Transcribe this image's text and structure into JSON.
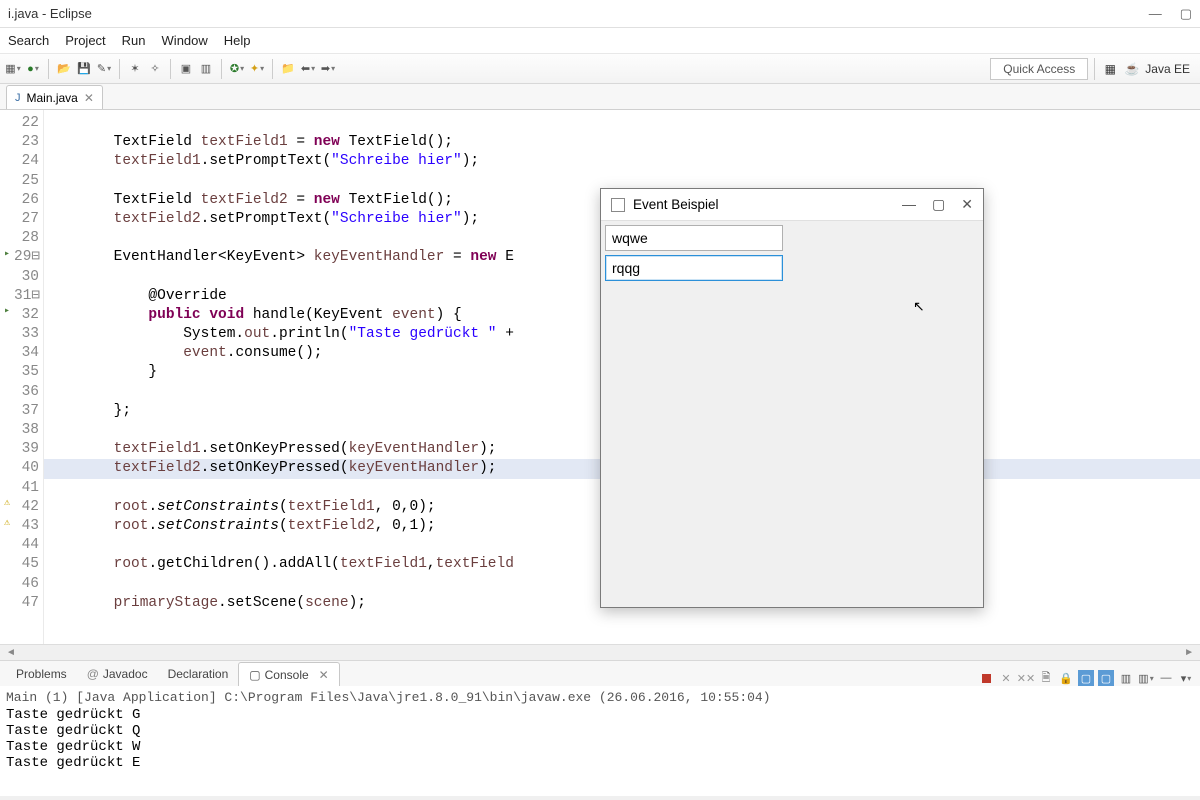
{
  "window": {
    "title": "i.java - Eclipse",
    "controls": {
      "minimize": "—",
      "maximize": "▢",
      "close": ""
    }
  },
  "menubar": [
    "Search",
    "Project",
    "Run",
    "Window",
    "Help"
  ],
  "toolbar": {
    "quick_access": "Quick Access",
    "perspective": "Java EE"
  },
  "editor": {
    "tab_label": "Main.java",
    "line_start": 22,
    "lines": [
      {
        "n": 22,
        "indent": "        ",
        "html": ""
      },
      {
        "n": 23,
        "indent": "        ",
        "tokens": [
          [
            "type",
            "TextField "
          ],
          [
            "name",
            "textField1"
          ],
          [
            "",
            " = "
          ],
          [
            "kw",
            "new"
          ],
          [
            "",
            " TextField();"
          ]
        ]
      },
      {
        "n": 24,
        "indent": "        ",
        "tokens": [
          [
            "name",
            "textField1"
          ],
          [
            "",
            ".setPromptText("
          ],
          [
            "str",
            "\"Schreibe hier\""
          ],
          [
            "",
            ");"
          ]
        ]
      },
      {
        "n": 25,
        "indent": "        ",
        "html": ""
      },
      {
        "n": 26,
        "indent": "        ",
        "tokens": [
          [
            "type",
            "TextField "
          ],
          [
            "name",
            "textField2"
          ],
          [
            "",
            " = "
          ],
          [
            "kw",
            "new"
          ],
          [
            "",
            " TextField();"
          ]
        ]
      },
      {
        "n": 27,
        "indent": "        ",
        "tokens": [
          [
            "name",
            "textField2"
          ],
          [
            "",
            ".setPromptText("
          ],
          [
            "str",
            "\"Schreibe hier\""
          ],
          [
            "",
            ");"
          ]
        ]
      },
      {
        "n": 28,
        "indent": "        ",
        "html": ""
      },
      {
        "n": 29,
        "indent": "        ",
        "fold": "minus",
        "gutter": "override",
        "tokens": [
          [
            "type",
            "EventHandler<KeyEvent> "
          ],
          [
            "name",
            "keyEventHandler"
          ],
          [
            "",
            " = "
          ],
          [
            "kw",
            "new"
          ],
          [
            "",
            " E"
          ]
        ]
      },
      {
        "n": 30,
        "indent": "            ",
        "html": ""
      },
      {
        "n": 31,
        "indent": "            ",
        "fold": "minus",
        "tokens": [
          [
            "",
            "@Override"
          ]
        ]
      },
      {
        "n": 32,
        "indent": "            ",
        "gutter": "override",
        "tokens": [
          [
            "kw",
            "public "
          ],
          [
            "kw",
            "void"
          ],
          [
            "",
            " handle(KeyEvent "
          ],
          [
            "name",
            "event"
          ],
          [
            "",
            ") {"
          ]
        ]
      },
      {
        "n": 33,
        "indent": "                ",
        "tokens": [
          [
            "",
            "System."
          ],
          [
            "name",
            "out"
          ],
          [
            "",
            ".println("
          ],
          [
            "str",
            "\"Taste gedrückt \""
          ],
          [
            "",
            " +"
          ]
        ]
      },
      {
        "n": 34,
        "indent": "                ",
        "tokens": [
          [
            "name",
            "event"
          ],
          [
            "",
            ".consume();"
          ]
        ]
      },
      {
        "n": 35,
        "indent": "            ",
        "tokens": [
          [
            "",
            "}"
          ]
        ]
      },
      {
        "n": 36,
        "indent": "            ",
        "html": ""
      },
      {
        "n": 37,
        "indent": "        ",
        "tokens": [
          [
            "",
            "};"
          ]
        ]
      },
      {
        "n": 38,
        "indent": "        ",
        "html": ""
      },
      {
        "n": 39,
        "indent": "        ",
        "tokens": [
          [
            "name",
            "textField1"
          ],
          [
            "",
            ".setOnKeyPressed("
          ],
          [
            "name",
            "keyEventHandler"
          ],
          [
            "",
            ");"
          ]
        ]
      },
      {
        "n": 40,
        "indent": "        ",
        "hl": true,
        "tokens": [
          [
            "name",
            "textField2"
          ],
          [
            "",
            ".setOnKeyPressed("
          ],
          [
            "name",
            "keyEventHandler"
          ],
          [
            "",
            ");"
          ]
        ]
      },
      {
        "n": 41,
        "indent": "        ",
        "html": ""
      },
      {
        "n": 42,
        "indent": "        ",
        "gutter": "warn",
        "tokens": [
          [
            "name",
            "root"
          ],
          [
            "",
            "."
          ],
          [
            "meth-it",
            "setConstraints"
          ],
          [
            "",
            "("
          ],
          [
            "name",
            "textField1"
          ],
          [
            "",
            ", 0,0);"
          ]
        ]
      },
      {
        "n": 43,
        "indent": "        ",
        "gutter": "warn",
        "tokens": [
          [
            "name",
            "root"
          ],
          [
            "",
            "."
          ],
          [
            "meth-it",
            "setConstraints"
          ],
          [
            "",
            "("
          ],
          [
            "name",
            "textField2"
          ],
          [
            "",
            ", 0,1);"
          ]
        ]
      },
      {
        "n": 44,
        "indent": "        ",
        "html": ""
      },
      {
        "n": 45,
        "indent": "        ",
        "tokens": [
          [
            "name",
            "root"
          ],
          [
            "",
            ".getChildren().addAll("
          ],
          [
            "name",
            "textField1"
          ],
          [
            "",
            ","
          ],
          [
            "name",
            "textField"
          ]
        ]
      },
      {
        "n": 46,
        "indent": "        ",
        "html": ""
      },
      {
        "n": 47,
        "indent": "        ",
        "tokens": [
          [
            "name",
            "primaryStage"
          ],
          [
            "",
            ".setScene("
          ],
          [
            "name",
            "scene"
          ],
          [
            "",
            ");"
          ]
        ]
      }
    ]
  },
  "bottom_panel": {
    "tabs": [
      "Problems",
      "Javadoc",
      "Declaration",
      "Console"
    ],
    "active": "Console",
    "run_desc": "Main (1) [Java Application] C:\\Program Files\\Java\\jre1.8.0_91\\bin\\javaw.exe (26.06.2016, 10:55:04)",
    "output": [
      "Taste gedrückt G",
      "Taste gedrückt Q",
      "Taste gedrückt W",
      "Taste gedrückt E"
    ]
  },
  "app_window": {
    "title": "Event Beispiel",
    "field1_value": "wqwe",
    "field2_value": "rqqg"
  }
}
